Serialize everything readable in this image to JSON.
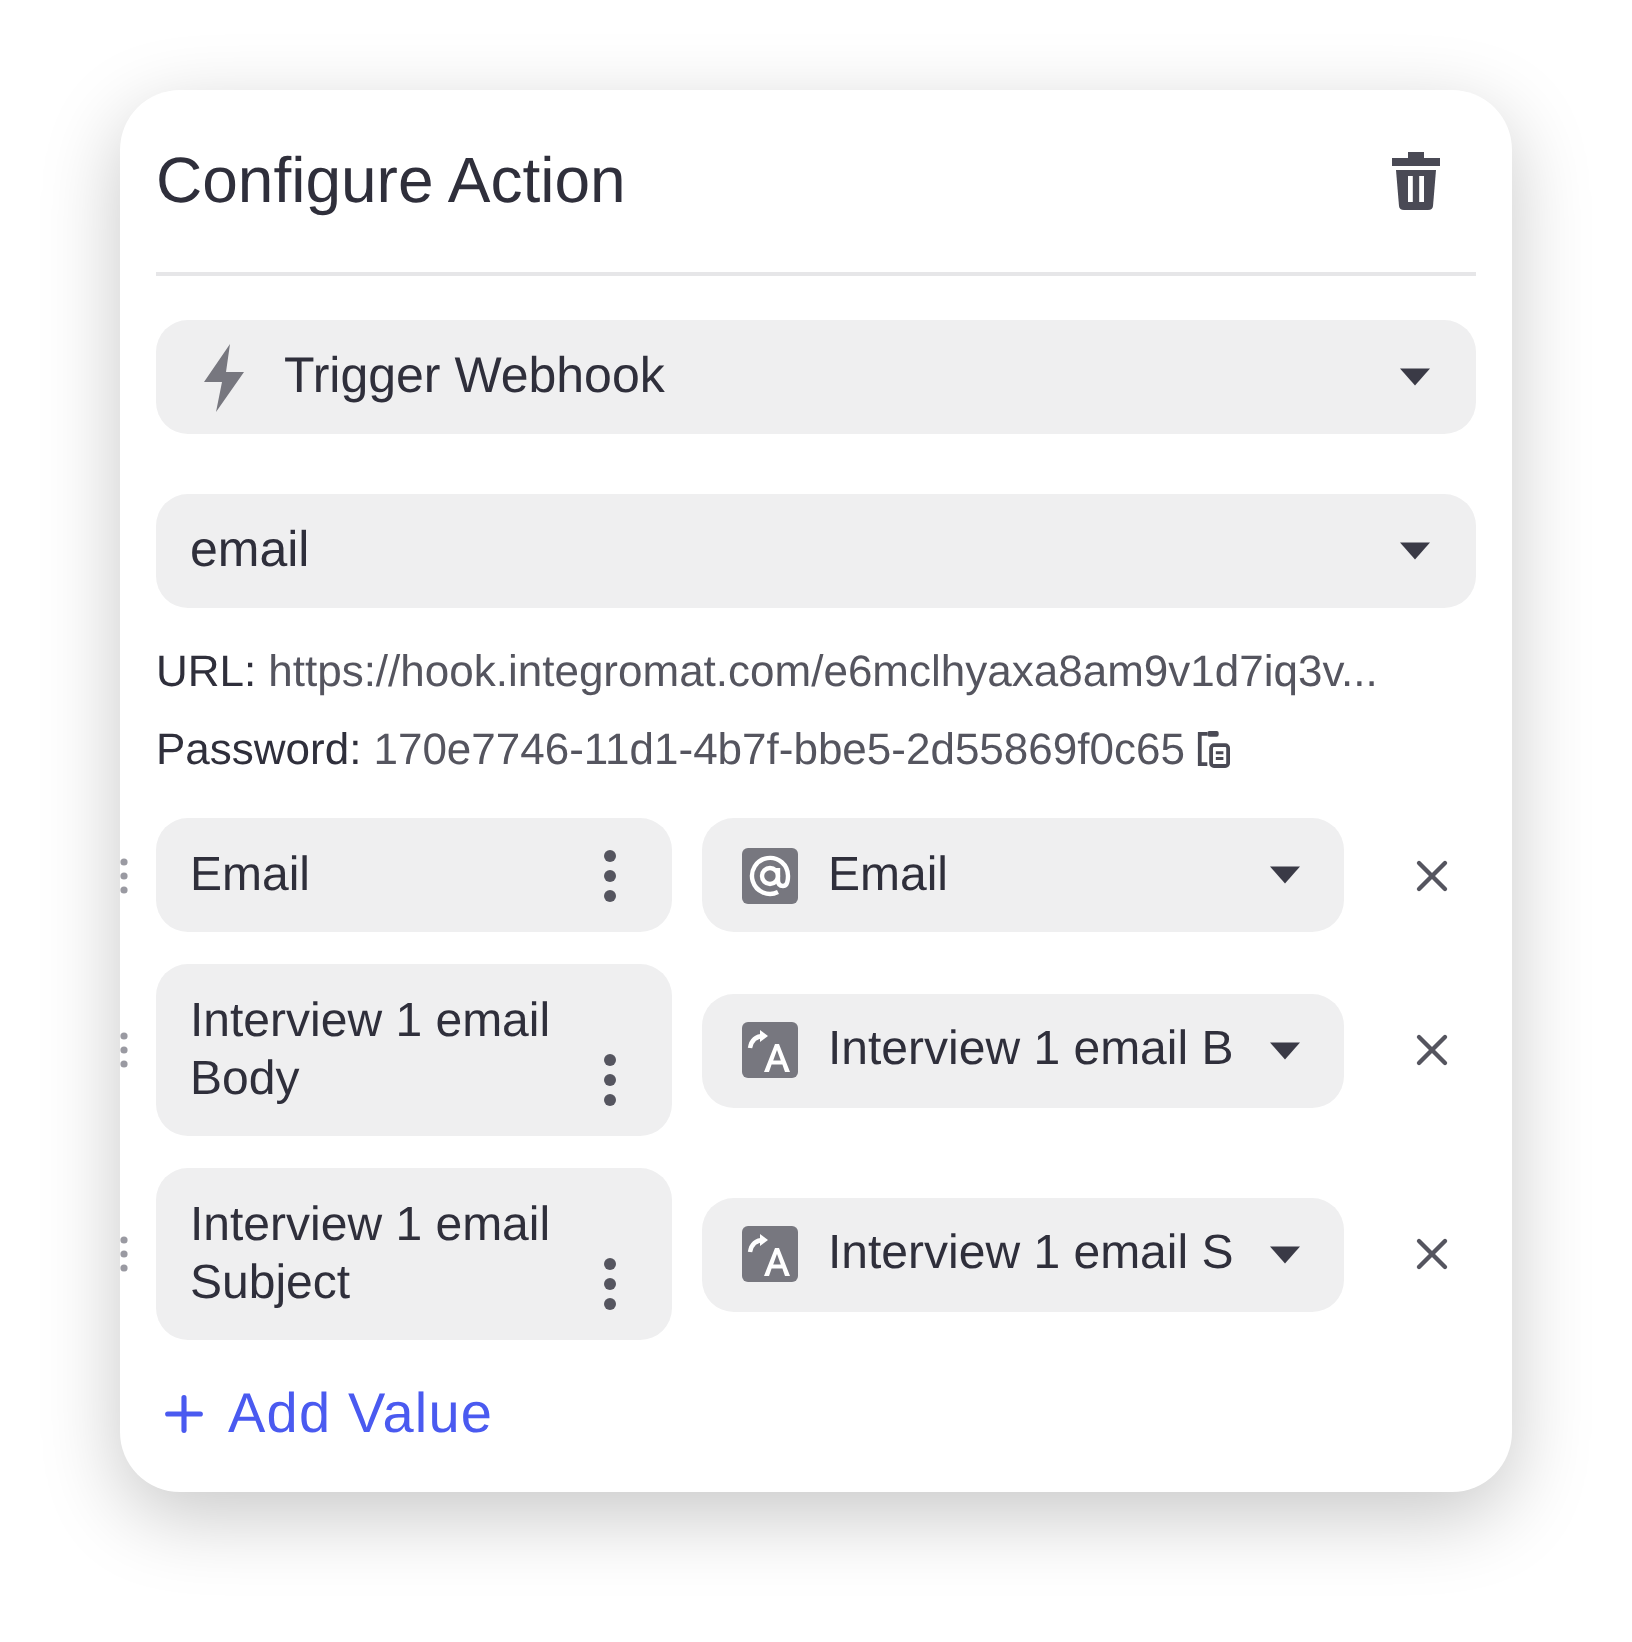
{
  "panel": {
    "title": "Configure Action"
  },
  "action_select": {
    "value": "Trigger Webhook"
  },
  "webhook_select": {
    "value": "email"
  },
  "info": [
    {
      "label": "URL:",
      "value": "https://hook.integromat.com/e6mclhyaxa8am9v1d7iq3v...",
      "copyable": false
    },
    {
      "label": "Password:",
      "value": "170e7746-11d1-4b7f-bbe5-2d55869f0c65",
      "copyable": true
    }
  ],
  "mappings": [
    {
      "name": "Email",
      "kind": "email",
      "value": "Email"
    },
    {
      "name": "Interview 1 email Body",
      "kind": "text",
      "value": "Interview 1 email B"
    },
    {
      "name": "Interview 1 email Subject",
      "kind": "text",
      "value": "Interview 1 email S"
    }
  ],
  "add_button": {
    "label": "Add Value"
  }
}
